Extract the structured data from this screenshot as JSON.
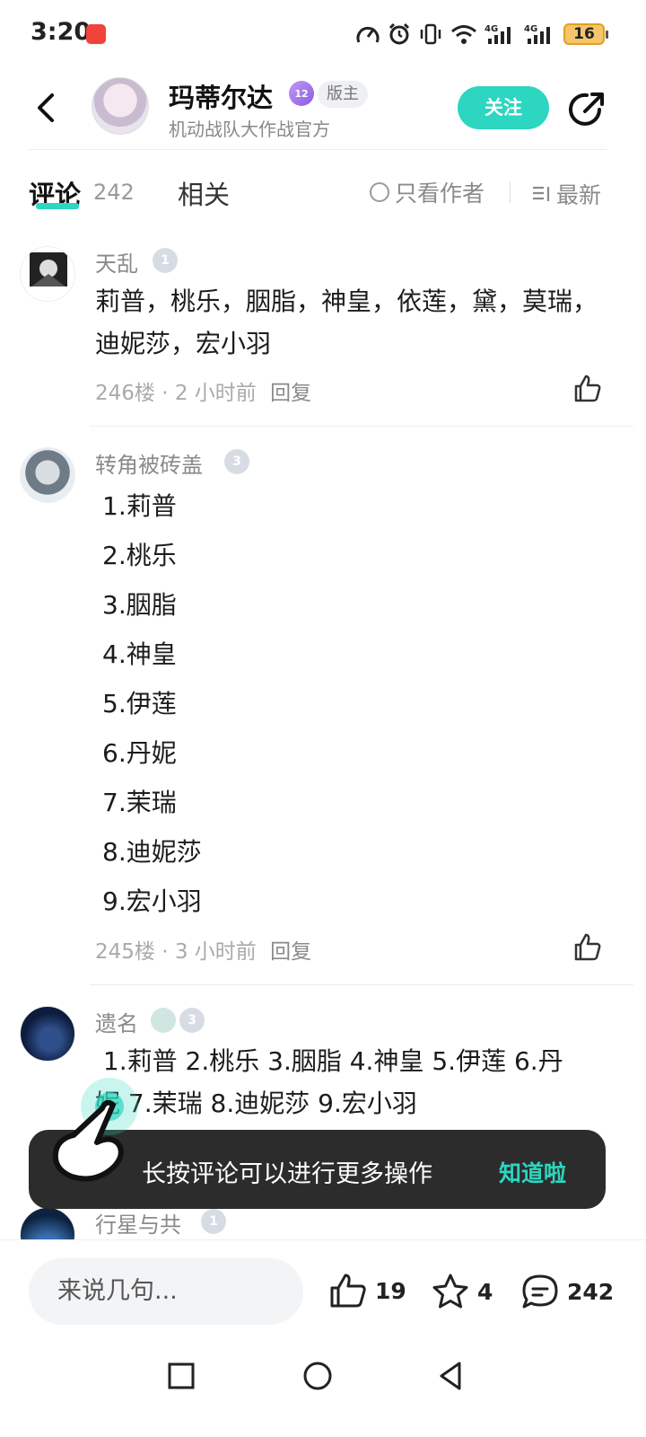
{
  "status_bar": {
    "time": "3:20",
    "battery": "16"
  },
  "header": {
    "author_name": "玛蒂尔达",
    "level_badge": "12",
    "role_badge": "版主",
    "subtitle": "机动战队大作战官方",
    "follow_label": "关注"
  },
  "tabs": {
    "comments_label": "评论",
    "comments_count": "242",
    "related_label": "相关",
    "filter_author": "只看作者",
    "sort_label": "最新"
  },
  "comments": [
    {
      "user": "天乱",
      "badge": "1",
      "text": "莉普，桃乐，胭脂，神皇，依莲，黛，莫瑞，迪妮莎，宏小羽",
      "floor": "246楼",
      "time": "2 小时前",
      "reply": "回复"
    },
    {
      "user": "转角被砖盖",
      "badge": "3",
      "list": [
        "1.莉普",
        "2.桃乐",
        "3.胭脂",
        "4.神皇",
        "5.伊莲",
        "6.丹妮",
        "7.茉瑞",
        "8.迪妮莎",
        "9.宏小羽"
      ],
      "floor": "245楼",
      "time": "3 小时前",
      "reply": "回复"
    },
    {
      "user": "遗名",
      "badge": "3",
      "line1": " 1.莉普 2.桃乐 3.胭脂 4.神皇 5.伊莲 6.丹",
      "line2": "妮 7.茉瑞 8.迪妮莎 9.宏小羽"
    },
    {
      "user": "行星与共",
      "badge": "1"
    }
  ],
  "toast": {
    "text": "长按评论可以进行更多操作",
    "action": "知道啦"
  },
  "bottom_bar": {
    "input_placeholder": "来说几句...",
    "likes": "19",
    "favorites": "4",
    "comments": "242"
  },
  "colors": {
    "accent": "#2cd6c0",
    "toast_bg": "#2c2c2c"
  }
}
